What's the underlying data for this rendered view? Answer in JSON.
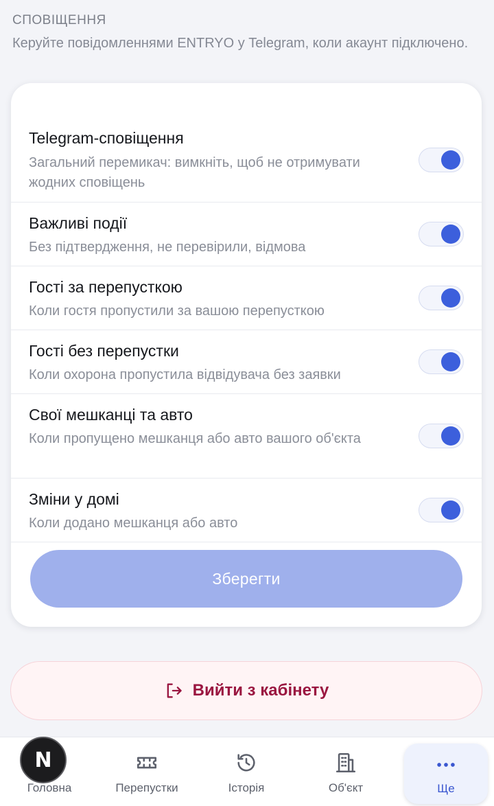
{
  "section": {
    "title": "СПОВІЩЕННЯ",
    "description": "Керуйте повідомленнями ENTRYO у Telegram, коли акаунт підключено."
  },
  "settings": [
    {
      "title": "Telegram-сповіщення",
      "subtitle": "Загальний перемикач: вимкніть, щоб не отримувати жодних сповіщень",
      "enabled": true
    },
    {
      "title": "Важливі події",
      "subtitle": "Без підтвердження, не перевірили, відмова",
      "enabled": true
    },
    {
      "title": "Гості за перепусткою",
      "subtitle": "Коли гостя пропустили за вашою перепусткою",
      "enabled": true
    },
    {
      "title": "Гості без перепустки",
      "subtitle": "Коли охорона пропустила відвідувача без заявки",
      "enabled": true
    },
    {
      "title": "Свої мешканці та авто",
      "subtitle": "Коли пропущено мешканця або авто вашого об'єкта",
      "enabled": true
    },
    {
      "title": "Зміни у домі",
      "subtitle": "Коли додано мешканця або авто",
      "enabled": true
    }
  ],
  "save_label": "Зберегти",
  "logout_label": "Вийти з кабінету",
  "tabs": [
    {
      "label": "Головна",
      "icon": "home-icon"
    },
    {
      "label": "Перепустки",
      "icon": "ticket-icon"
    },
    {
      "label": "Історія",
      "icon": "history-icon"
    },
    {
      "label": "Об'єкт",
      "icon": "building-icon"
    },
    {
      "label": "Ще",
      "icon": "more-icon",
      "active": true
    }
  ],
  "badge_letter": "N",
  "colors": {
    "accent": "#3c5fdc",
    "save_disabled": "#9fb0ec",
    "logout_text": "#9a1640",
    "logout_bg": "#fff4f5"
  }
}
